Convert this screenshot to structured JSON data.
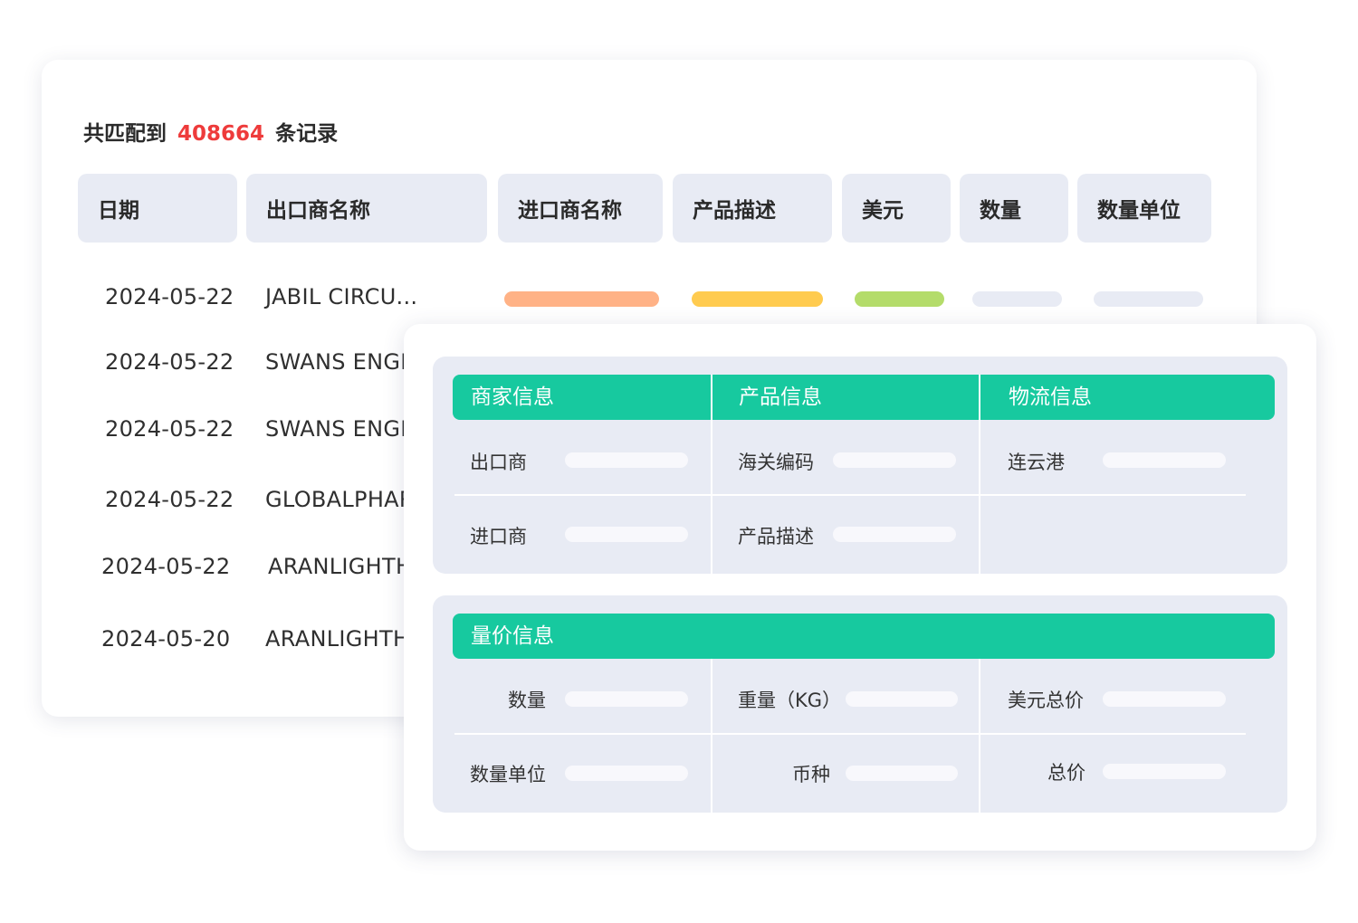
{
  "summary": {
    "prefix": "共匹配到",
    "count": "408664",
    "suffix": "条记录"
  },
  "table": {
    "headers": [
      "日期",
      "出口商名称",
      "进口商名称",
      "产品描述",
      "美元",
      "数量",
      "数量单位"
    ],
    "rows": [
      {
        "date": "2024-05-22",
        "exporter": "JABIL CIRCU..."
      },
      {
        "date": "2024-05-22",
        "exporter": "SWANS ENGI"
      },
      {
        "date": "2024-05-22",
        "exporter": "SWANS ENGI"
      },
      {
        "date": "2024-05-22",
        "exporter": "GLOBALPHAR"
      },
      {
        "date": "2024-05-22",
        "exporter": "ARANLIGHTH"
      },
      {
        "date": "2024-05-20",
        "exporter": "ARANLIGHTH"
      }
    ],
    "placeholder_colors": [
      "#ffb286",
      "#ffcb4f",
      "#b4dc6a",
      "#e8ebf4",
      "#e8ebf4"
    ]
  },
  "detail": {
    "panel1": {
      "sections": [
        "商家信息",
        "产品信息",
        "物流信息"
      ],
      "fields": [
        "出口商",
        "海关编码",
        "连云港",
        "进口商",
        "产品描述"
      ]
    },
    "panel2": {
      "section": "量价信息",
      "fields": [
        "数量",
        "重量（KG）",
        "美元总价",
        "数量单位",
        "币种",
        "总价"
      ]
    }
  },
  "colors": {
    "accent_green": "#17c99f",
    "count_red": "#ee3b3b",
    "header_bg": "#e8ebf4"
  }
}
